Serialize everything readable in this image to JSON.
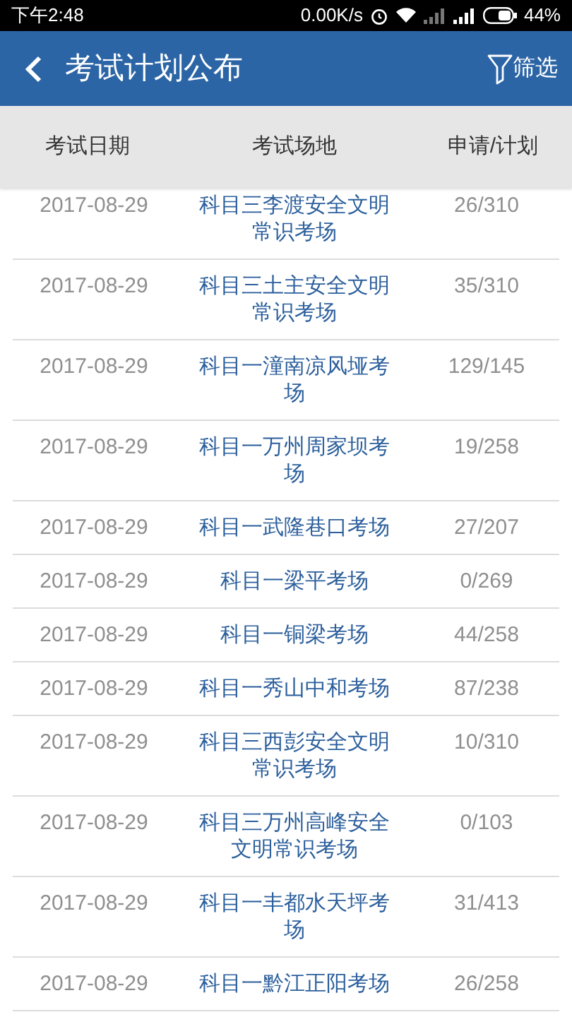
{
  "status_bar": {
    "time": "下午2:48",
    "speed": "0.00K/s",
    "battery": "44%"
  },
  "app_bar": {
    "title": "考试计划公布",
    "filter": "筛选"
  },
  "table": {
    "columns": [
      "考试日期",
      "考试场地",
      "申请/计划"
    ],
    "rows": [
      {
        "date": "2017-08-29",
        "venue": "科目三李渡安全文明常识考场",
        "count": "26/310"
      },
      {
        "date": "2017-08-29",
        "venue": "科目三土主安全文明常识考场",
        "count": "35/310"
      },
      {
        "date": "2017-08-29",
        "venue": "科目一潼南凉风垭考场",
        "count": "129/145"
      },
      {
        "date": "2017-08-29",
        "venue": "科目一万州周家坝考场",
        "count": "19/258"
      },
      {
        "date": "2017-08-29",
        "venue": "科目一武隆巷口考场",
        "count": "27/207"
      },
      {
        "date": "2017-08-29",
        "venue": "科目一梁平考场",
        "count": "0/269"
      },
      {
        "date": "2017-08-29",
        "venue": "科目一铜梁考场",
        "count": "44/258"
      },
      {
        "date": "2017-08-29",
        "venue": "科目一秀山中和考场",
        "count": "87/238"
      },
      {
        "date": "2017-08-29",
        "venue": "科目三西彭安全文明常识考场",
        "count": "10/310"
      },
      {
        "date": "2017-08-29",
        "venue": "科目三万州高峰安全文明常识考场",
        "count": "0/103"
      },
      {
        "date": "2017-08-29",
        "venue": "科目一丰都水天坪考场",
        "count": "31/413"
      },
      {
        "date": "2017-08-29",
        "venue": "科目一黔江正阳考场",
        "count": "26/258"
      }
    ]
  }
}
